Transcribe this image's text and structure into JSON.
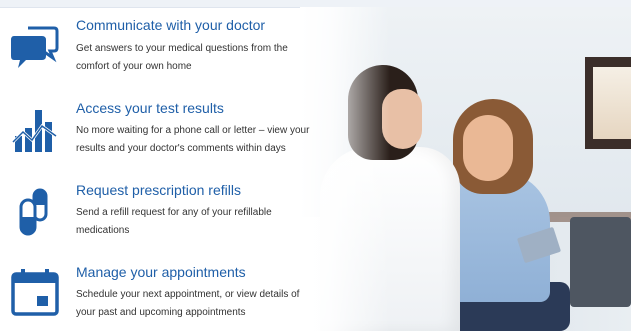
{
  "accent_color": "#1f5fa8",
  "features": [
    {
      "icon": "chat-bubbles-icon",
      "title": "Communicate with your doctor",
      "line1": "Get answers to your medical questions from the",
      "line2": "comfort of your own home"
    },
    {
      "icon": "bar-chart-icon",
      "title": "Access your test results",
      "line1": "No more waiting for a phone call or letter – view your",
      "line2": "results and your doctor's comments within days"
    },
    {
      "icon": "pill-capsules-icon",
      "title": "Request prescription refills",
      "line1": "Send a refill request for any of your refillable",
      "line2": "medications"
    },
    {
      "icon": "calendar-icon",
      "title": "Manage your appointments",
      "line1": "Schedule your next appointment, or view details of",
      "line2": "your past and upcoming appointments"
    }
  ]
}
